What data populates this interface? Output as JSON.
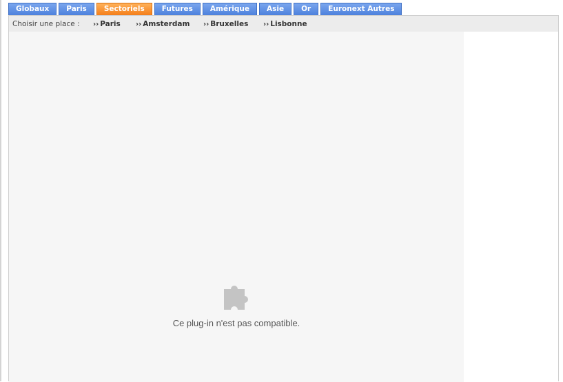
{
  "tabs": [
    {
      "label": "Globaux",
      "active": false
    },
    {
      "label": "Paris",
      "active": false
    },
    {
      "label": "Sectoriels",
      "active": true
    },
    {
      "label": "Futures",
      "active": false
    },
    {
      "label": "Amérique",
      "active": false
    },
    {
      "label": "Asie",
      "active": false
    },
    {
      "label": "Or",
      "active": false
    },
    {
      "label": "Euronext Autres",
      "active": false
    }
  ],
  "places": {
    "label": "Choisir une place :",
    "items": [
      {
        "label": "Paris"
      },
      {
        "label": "Amsterdam"
      },
      {
        "label": "Bruxelles"
      },
      {
        "label": "Lisbonne"
      }
    ]
  },
  "plugin": {
    "message": "Ce plug-in n'est pas compatible.",
    "icon": "puzzle-piece-icon"
  },
  "colors": {
    "tab_blue": "#5a8ce4",
    "tab_active_orange": "#f58a26",
    "subnav_bg": "#ececec",
    "plugin_bg": "#f6f6f6"
  }
}
